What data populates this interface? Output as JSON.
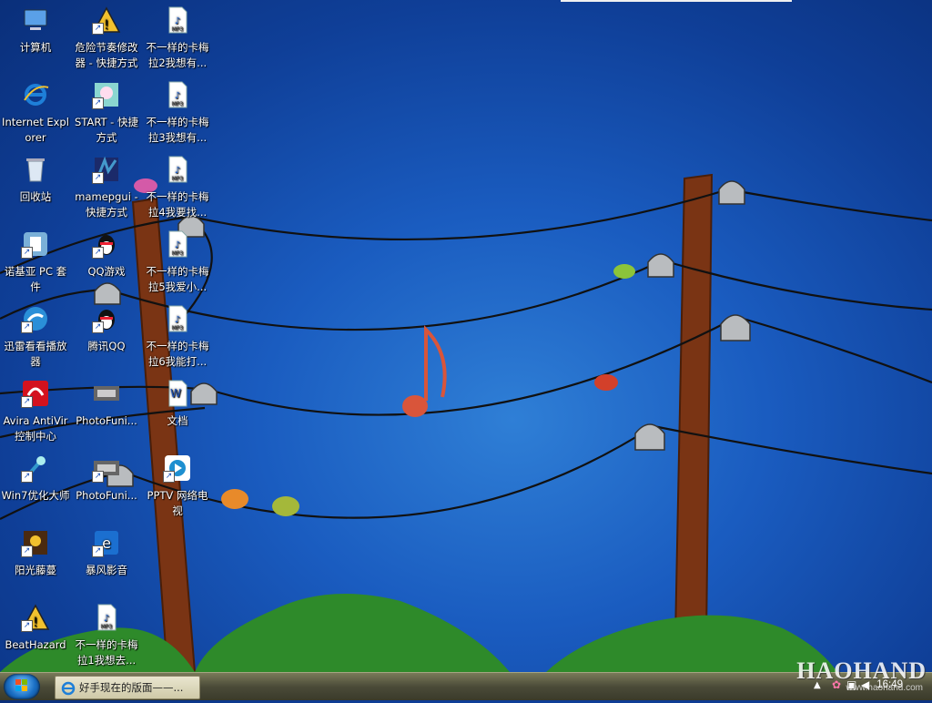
{
  "desktop": {
    "icons": [
      {
        "id": "computer",
        "label": "计算机",
        "icon": "computer-icon",
        "shortcut": false
      },
      {
        "id": "danger-rhythm",
        "label": "危险节奏修改器 - 快捷方式",
        "icon": "warning-sign-icon",
        "shortcut": true
      },
      {
        "id": "mp3-2",
        "label": "不一样的卡梅拉2我想有...",
        "icon": "mp3-file-icon",
        "shortcut": false
      },
      {
        "id": "ie",
        "label": "Internet Explorer",
        "icon": "internet-explorer-icon",
        "shortcut": false
      },
      {
        "id": "start",
        "label": "START - 快捷方式",
        "icon": "anime-girl-icon",
        "shortcut": true
      },
      {
        "id": "mp3-3",
        "label": "不一样的卡梅拉3我想有...",
        "icon": "mp3-file-icon",
        "shortcut": false
      },
      {
        "id": "recycle",
        "label": "回收站",
        "icon": "recycle-bin-icon",
        "shortcut": false
      },
      {
        "id": "mamepgui",
        "label": "mamepgui - 快捷方式",
        "icon": "mame-icon",
        "shortcut": true
      },
      {
        "id": "mp3-4",
        "label": "不一样的卡梅拉4我要找...",
        "icon": "mp3-file-icon",
        "shortcut": false
      },
      {
        "id": "nokia",
        "label": "诺基亚 PC 套件",
        "icon": "nokia-pc-suite-icon",
        "shortcut": true
      },
      {
        "id": "qqgame",
        "label": "QQ游戏",
        "icon": "qq-penguin-icon",
        "shortcut": true
      },
      {
        "id": "mp3-5",
        "label": "不一样的卡梅拉5我爱小...",
        "icon": "mp3-file-icon",
        "shortcut": false
      },
      {
        "id": "xunlei",
        "label": "迅雷看看播放器",
        "icon": "xunlei-icon",
        "shortcut": true
      },
      {
        "id": "tencentqq",
        "label": "腾讯QQ",
        "icon": "qq-penguin-icon",
        "shortcut": true
      },
      {
        "id": "mp3-6",
        "label": "不一样的卡梅拉6我能打...",
        "icon": "mp3-file-icon",
        "shortcut": false
      },
      {
        "id": "avira",
        "label": "Avira AntiVir 控制中心",
        "icon": "avira-umbrella-icon",
        "shortcut": true
      },
      {
        "id": "photofuni1",
        "label": "PhotoFuni...",
        "icon": "car-photo-icon",
        "shortcut": false
      },
      {
        "id": "doc",
        "label": "文档",
        "icon": "word-document-icon",
        "shortcut": false
      },
      {
        "id": "win7opt",
        "label": "Win7优化大师",
        "icon": "optimizer-icon",
        "shortcut": true
      },
      {
        "id": "photofuni2",
        "label": "PhotoFuni...",
        "icon": "car-photo-icon",
        "shortcut": true
      },
      {
        "id": "pptv",
        "label": "PPTV 网络电视",
        "icon": "pptv-icon",
        "shortcut": true
      },
      {
        "id": "sunflower",
        "label": "阳光藤蔓",
        "icon": "game-character-icon",
        "shortcut": true
      },
      {
        "id": "baofeng",
        "label": "暴风影音",
        "icon": "baofeng-icon",
        "shortcut": true
      },
      {
        "id": "beathazard",
        "label": "BeatHazard",
        "icon": "warning-sign-icon",
        "shortcut": true
      },
      {
        "id": "mp3-1",
        "label": "不一样的卡梅拉1我想去...",
        "icon": "mp3-file-icon",
        "shortcut": false
      }
    ]
  },
  "taskbar": {
    "start_label": "",
    "active_task": {
      "label": "好手现在的版面——...",
      "icon": "internet-explorer-icon"
    },
    "clock": "16:49"
  },
  "watermark": {
    "brand": "HAOHAND",
    "url": "www.haohand.com"
  },
  "colors": {
    "sky_top": "#0a2f7a",
    "sky_center": "#2f7fd6",
    "grass": "#2e8a2a",
    "pole": "#7a3414",
    "taskbar": "#4b4b38"
  }
}
